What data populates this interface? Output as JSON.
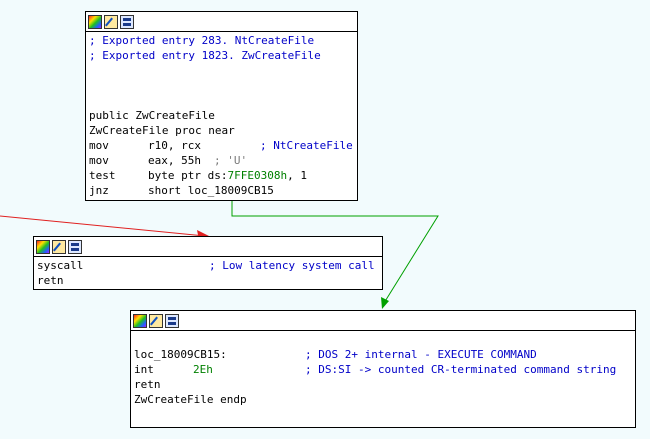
{
  "colors": {
    "background": "#f2fbfd",
    "comment": "#0000c8",
    "false_edge": "#e02020",
    "true_edge": "#00a000"
  },
  "toolbar_icons": [
    "color-palette-icon",
    "rename-icon",
    "graph-view-icon"
  ],
  "block1": {
    "comment1": "; Exported entry 283. NtCreateFile",
    "comment2": "; Exported entry 1823. ZwCreateFile",
    "public_line": "public ZwCreateFile",
    "proc_line": "ZwCreateFile proc near",
    "mov1_mnem": "mov",
    "mov1_ops": "r10, rcx",
    "mov1_cmt": "; NtCreateFile",
    "mov2_mnem": "mov",
    "mov2_ops": "eax, 55h",
    "mov2_cmt": "; 'U'",
    "test_mnem": "test",
    "test_ops_pre": "byte ptr ds:",
    "test_ops_addr": "7FFE0308h",
    "test_ops_post": ", 1",
    "jnz_mnem": "jnz",
    "jnz_ops": "short loc_18009CB15"
  },
  "block2": {
    "syscall_mnem": "syscall",
    "syscall_cmt": "; Low latency system call",
    "retn_mnem": "retn"
  },
  "block3": {
    "label": "loc_18009CB15:",
    "label_cmt": "; DOS 2+ internal - EXECUTE COMMAND",
    "int_mnem": "int",
    "int_ops": "2Eh",
    "int_cmt": "; DS:SI -> counted CR-terminated command string",
    "retn_mnem": "retn",
    "endp_line": "ZwCreateFile endp"
  }
}
